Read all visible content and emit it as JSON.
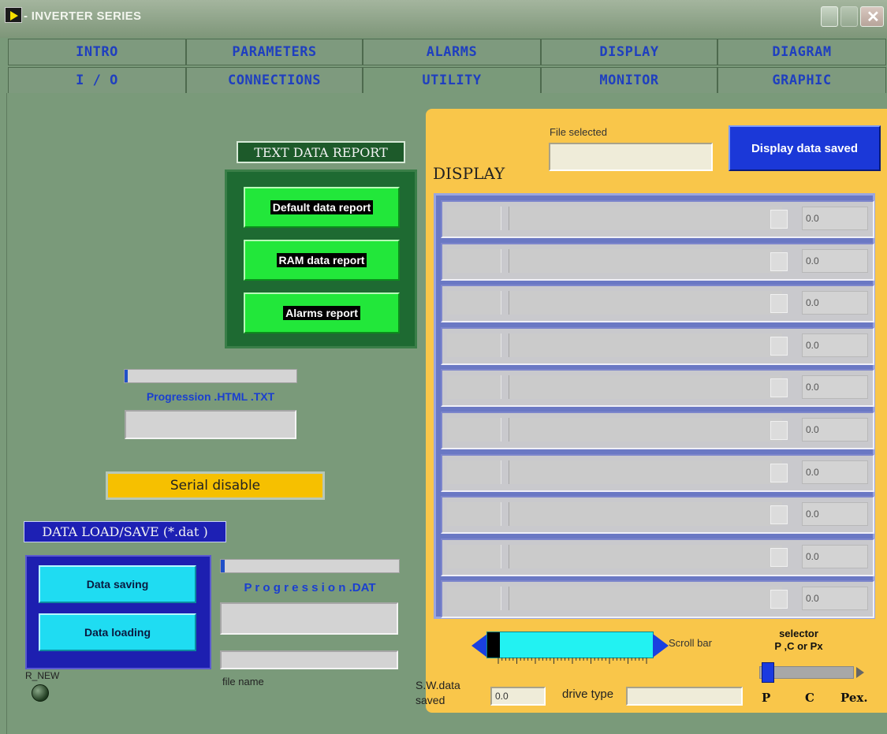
{
  "window": {
    "title": "- INVERTER SERIES"
  },
  "tabs_row1": [
    "INTRO",
    "PARAMETERS",
    "ALARMS",
    "DISPLAY",
    "DIAGRAM"
  ],
  "tabs_row2": [
    "I / O",
    "CONNECTIONS",
    "UTILITY",
    "MONITOR",
    "GRAPHIC"
  ],
  "active_tab": "UTILITY",
  "text_report": {
    "title": "TEXT DATA REPORT",
    "buttons": [
      "Default data report",
      "RAM data report",
      "Alarms report"
    ]
  },
  "progress_html": {
    "label": "Progression .HTML .TXT",
    "fraction": 0.02
  },
  "serial": {
    "text": "Serial disable",
    "color": "#f6c000"
  },
  "data_load_save": {
    "title": "DATA LOAD/SAVE (*.dat )",
    "buttons": [
      "Data saving",
      "Data loading"
    ]
  },
  "progress_dat": {
    "label": "P r o g r e s s i o n .DAT",
    "fraction": 0.02
  },
  "file_name_label": "file name",
  "led_label": "R_NEW",
  "display": {
    "title": "DISPLAY",
    "file_selected_label": "File selected",
    "save_button": "Display data saved",
    "rows": [
      "0.0",
      "0.0",
      "0.0",
      "0.0",
      "0.0",
      "0.0",
      "0.0",
      "0.0",
      "0.0",
      "0.0"
    ],
    "scroll_label": "Scroll bar",
    "selector_label": "selector\nP ,C or Px",
    "selector_options": [
      "P",
      "C",
      "Pex."
    ],
    "sw_label": "S.W.data saved",
    "sw_value": "0.0",
    "drive_type_label": "drive type"
  }
}
